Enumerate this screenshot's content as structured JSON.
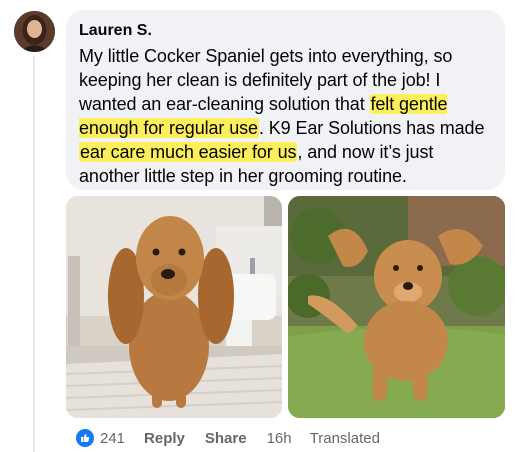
{
  "comment": {
    "author": "Lauren S.",
    "text_parts": [
      "My little Cocker Spaniel gets into everything, so keeping her clean is definitely part of the job! I wanted an ear-cleaning solution that ",
      "felt gentle enough for regular use",
      ". K9 Ear Solutions has made ",
      "ear care much easier for us",
      ", and now it’s just another little step in her grooming routine."
    ]
  },
  "reactions": {
    "icon": "thumbs-up-icon",
    "count": "241",
    "color": "#1877f2"
  },
  "actions": {
    "reply": "Reply",
    "share": "Share",
    "time": "16h",
    "translated": "Translated"
  },
  "colors": {
    "bubble": "#f0f2f5",
    "highlight": "#fcee5c",
    "meta_text": "#65676b"
  }
}
